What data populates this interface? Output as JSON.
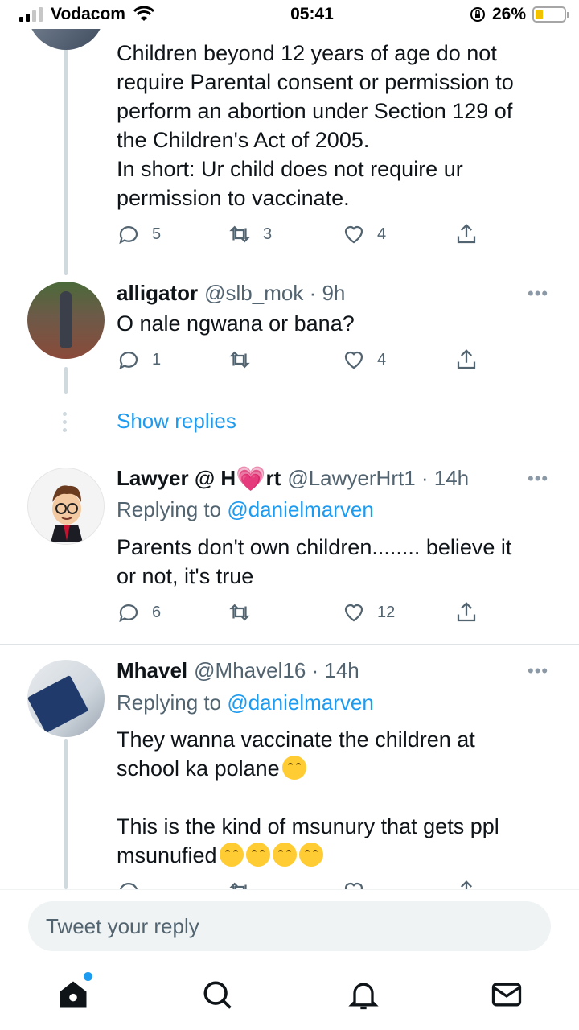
{
  "status_bar": {
    "carrier": "Vodacom",
    "time": "05:41",
    "battery": "26%",
    "battery_level": 0.26
  },
  "tweets": [
    {
      "text_lines": [
        "Children beyond 12 years of age do not",
        "require Parental consent or permission to",
        "perform an abortion under Section 129 of",
        "the Children's Act of 2005.",
        "In short: Ur child does not require ur",
        "permission to vaccinate."
      ],
      "replies": "5",
      "retweets": "3",
      "likes": "4"
    },
    {
      "name": "alligator",
      "handle": "@slb_mok · 9h",
      "text": "O nale ngwana or bana?",
      "replies": "1",
      "retweets": "",
      "likes": "4"
    },
    {
      "name_part1": "Lawyer @ H",
      "name_emoji": "💗",
      "name_part2": "rt",
      "handle": "@LawyerHrt1 · 14h",
      "replying_prefix": "Replying to",
      "replying_mention": "@danielmarven",
      "text_lines": [
        "Parents don't own children........ believe it",
        "or not, it's true"
      ],
      "replies": "6",
      "retweets": "",
      "likes": "12"
    },
    {
      "name": "Mhavel",
      "handle": "@Mhavel16 · 14h",
      "replying_prefix": "Replying to",
      "replying_mention": "@danielmarven",
      "text_lines": [
        "They wanna vaccinate the children at",
        "school ka polane",
        "This is the kind of msunury that gets ppl",
        "msunufied"
      ],
      "replies": "",
      "retweets": "",
      "likes": ""
    }
  ],
  "show_replies": "Show replies",
  "more_label": "•••",
  "reply_bar": {
    "placeholder": "Tweet your reply"
  },
  "tabbar": [
    "home-icon",
    "search-icon",
    "notifications-icon",
    "messages-icon"
  ],
  "colors": {
    "accent": "#1d9bf0",
    "text": "#0f1419",
    "muted": "#536471"
  }
}
